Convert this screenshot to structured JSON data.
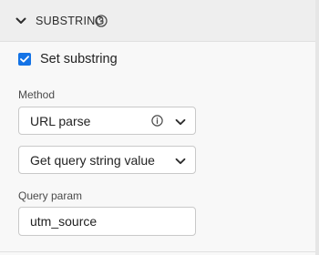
{
  "section": {
    "title": "SUBSTRING",
    "expanded": true,
    "collapse_icon": "chevron-down-icon",
    "help_icon": "help-circle-icon"
  },
  "set_substring": {
    "label": "Set substring",
    "checked": true,
    "accent_color": "#1473e6"
  },
  "method": {
    "label": "Method",
    "selected": "URL parse",
    "info_icon": "info-icon",
    "sub_selected": "Get query string value"
  },
  "query_param": {
    "label": "Query param",
    "value": "utm_source"
  }
}
